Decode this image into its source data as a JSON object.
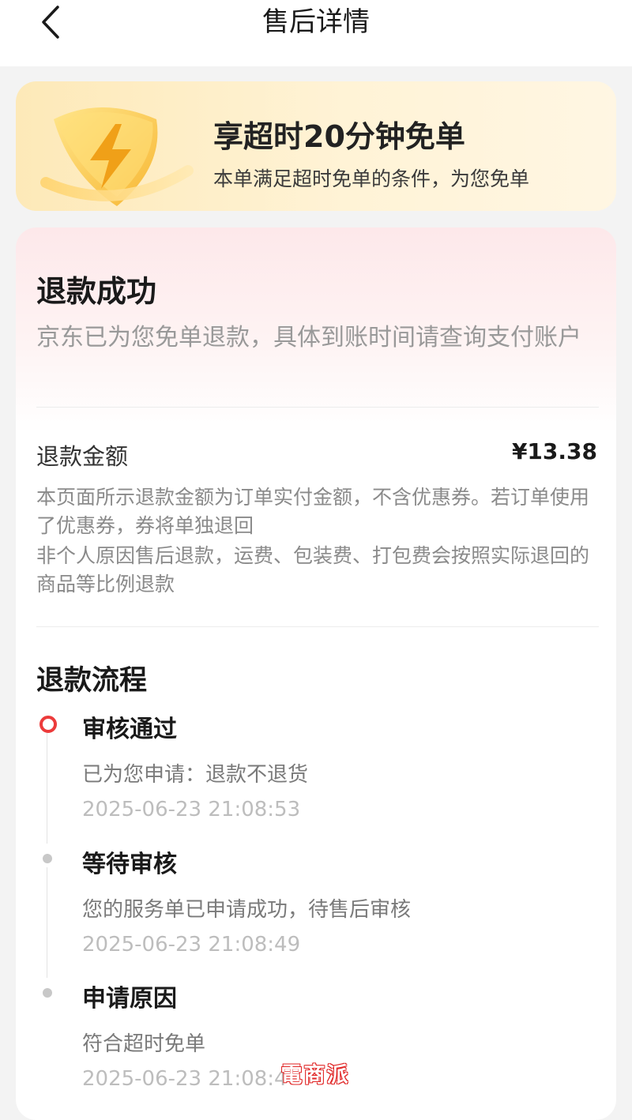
{
  "header": {
    "title": "售后详情",
    "back_icon": "chevron-left-icon"
  },
  "promo": {
    "icon": "lightning-shield-icon",
    "title": "享超时20分钟免单",
    "subtitle": "本单满足超时免单的条件，为您免单"
  },
  "refund": {
    "status": "退款成功",
    "description": "京东已为您免单退款，具体到账时间请查询支付账户",
    "amount_label": "退款金额",
    "amount_value": "¥13.38",
    "notes": [
      "本页面所示退款金额为订单实付金额，不含优惠券。若订单使用了优惠券，券将单独退回",
      "非个人原因售后退款，运费、包装费、打包费会按照实际退回的商品等比例退款"
    ]
  },
  "flow": {
    "title": "退款流程",
    "steps": [
      {
        "title": "审核通过",
        "desc": "已为您申请：退款不退货",
        "time": "2025-06-23 21:08:53",
        "state": "active"
      },
      {
        "title": "等待审核",
        "desc": "您的服务单已申请成功，待售后审核",
        "time": "2025-06-23 21:08:49",
        "state": "inactive"
      },
      {
        "title": "申请原因",
        "desc": "符合超时免单",
        "time": "2025-06-23 21:08:4",
        "state": "inactive"
      }
    ]
  },
  "watermark": {
    "text": "電商派"
  },
  "colors": {
    "accent_red": "#ec3b3b",
    "promo_bg": "#fde9b8",
    "muted_text": "#999999"
  }
}
